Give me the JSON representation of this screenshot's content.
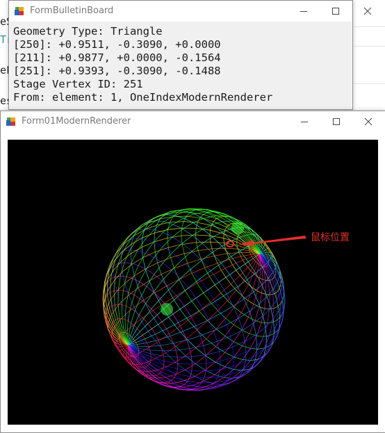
{
  "background": {
    "fragments": [
      "eS",
      "Tr",
      "eFa",
      "es"
    ]
  },
  "bulletin_window": {
    "title": "FormBulletinBoard",
    "lines": [
      "Geometry Type: Triangle",
      "[250]: +0.9511, -0.3090, +0.0000",
      "[211]: +0.9877, +0.0000, -0.1564",
      "[251]: +0.9393, -0.3090, -0.1488",
      "Stage Vertex ID: 251",
      "From: element: 1, OneIndexModernRenderer"
    ]
  },
  "renderer_window": {
    "title": "Form01ModernRenderer",
    "annotation": "鼠标位置"
  },
  "colors": {
    "annotation_red": "#e0302a",
    "canvas_bg": "#000000"
  },
  "icons": [
    "app-icon",
    "minimize-icon",
    "maximize-icon",
    "close-icon"
  ]
}
